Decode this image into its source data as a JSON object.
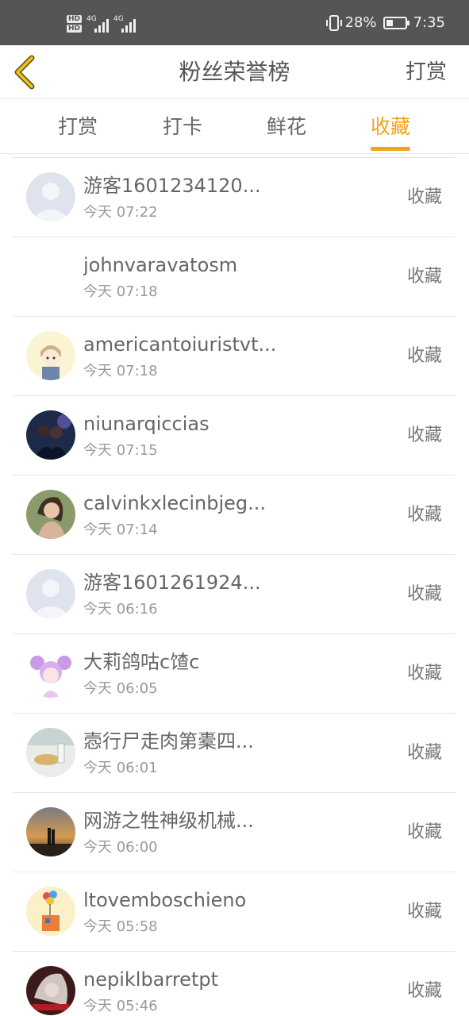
{
  "status_bar": {
    "hd_top": "HD",
    "hd_bottom": "HD",
    "net1": "4G",
    "net2": "4G",
    "battery": "28%",
    "time": "7:35",
    "icons": [
      "vibrate-icon",
      "battery-charging-icon",
      "signal-icon"
    ]
  },
  "navbar": {
    "back_icon": "chevron-left-icon",
    "title": "粉丝荣誉榜",
    "action": "打赏"
  },
  "tabs": [
    {
      "label": "打赏",
      "active": false
    },
    {
      "label": "打卡",
      "active": false
    },
    {
      "label": "鲜花",
      "active": false
    },
    {
      "label": "收藏",
      "active": true
    }
  ],
  "colors": {
    "accent": "#f0a31c",
    "status_bar": "#555555"
  },
  "rows": [
    {
      "name": "游客1601234120...",
      "time": "今天 07:22",
      "type": "收藏",
      "avatar": "default-user-icon"
    },
    {
      "name": "johnvaravatosm",
      "time": "今天 07:18",
      "type": "收藏",
      "avatar": "none"
    },
    {
      "name": "americantoiuristvt...",
      "time": "今天 07:18",
      "type": "收藏",
      "avatar": "cartoon-boy-avatar"
    },
    {
      "name": "niunarqiccias",
      "time": "今天 07:15",
      "type": "收藏",
      "avatar": "photo-couple-avatar"
    },
    {
      "name": "calvinkxlecinbjeg...",
      "time": "今天 07:14",
      "type": "收藏",
      "avatar": "photo-woman-avatar"
    },
    {
      "name": "游客1601261924...",
      "time": "今天 06:16",
      "type": "收藏",
      "avatar": "default-user-icon"
    },
    {
      "name": "大莉鸽咕c馇c",
      "time": "今天 06:05",
      "type": "收藏",
      "avatar": "cartoon-girl-avatar"
    },
    {
      "name": "悫行尸走肉第橐四...",
      "time": "今天 06:01",
      "type": "收藏",
      "avatar": "photo-food-avatar"
    },
    {
      "name": "网游之牲神级机械...",
      "time": "今天 06:00",
      "type": "收藏",
      "avatar": "photo-sunset-avatar"
    },
    {
      "name": "ltovemboschieno",
      "time": "今天 05:58",
      "type": "收藏",
      "avatar": "cartoon-balloon-avatar"
    },
    {
      "name": "nepiklbarretpt",
      "time": "今天 05:46",
      "type": "收藏",
      "avatar": "photo-dark-avatar"
    }
  ]
}
